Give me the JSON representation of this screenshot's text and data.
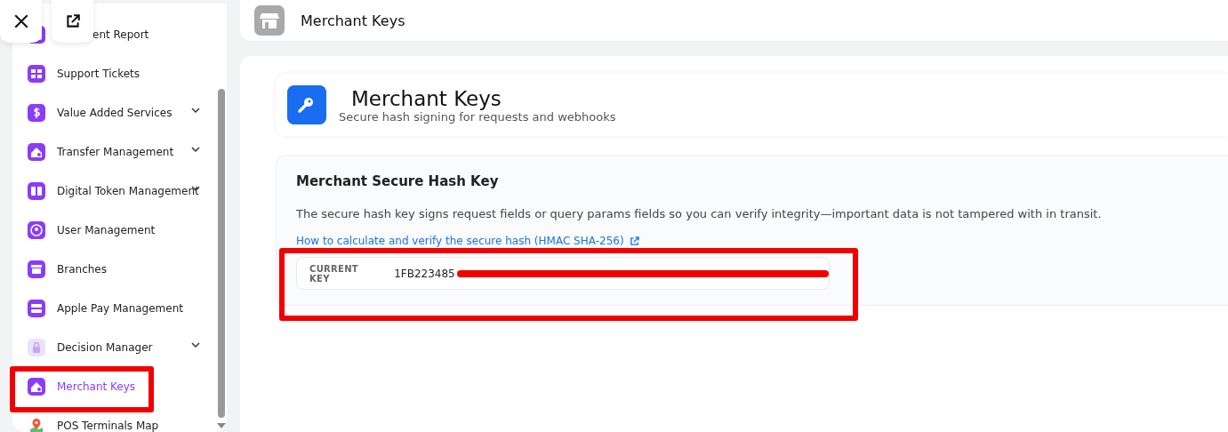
{
  "overlay_buttons": [
    {
      "kind": "close"
    },
    {
      "kind": "external"
    }
  ],
  "sidebar": {
    "items": [
      {
        "label": "ent Report",
        "expandable": false,
        "selected": false,
        "locked": false,
        "highlighted": false
      },
      {
        "label": "Support Tickets",
        "expandable": false,
        "selected": false,
        "locked": false,
        "highlighted": false
      },
      {
        "label": "Value Added Services",
        "expandable": true,
        "selected": false,
        "locked": false,
        "highlighted": false
      },
      {
        "label": "Transfer Management",
        "expandable": true,
        "selected": false,
        "locked": false,
        "highlighted": false
      },
      {
        "label": "Digital Token Management",
        "expandable": true,
        "selected": false,
        "locked": false,
        "highlighted": false
      },
      {
        "label": "User Management",
        "expandable": false,
        "selected": false,
        "locked": false,
        "highlighted": false
      },
      {
        "label": "Branches",
        "expandable": false,
        "selected": false,
        "locked": false,
        "highlighted": false
      },
      {
        "label": "Apple Pay Management",
        "expandable": false,
        "selected": false,
        "locked": false,
        "highlighted": false
      },
      {
        "label": "Decision Manager",
        "expandable": true,
        "selected": false,
        "locked": true,
        "highlighted": false
      },
      {
        "label": "Merchant Keys",
        "expandable": false,
        "selected": true,
        "locked": false,
        "highlighted": true
      },
      {
        "label": "POS Terminals Map",
        "expandable": false,
        "selected": false,
        "locked": false,
        "highlighted": false
      }
    ]
  },
  "top_bar": {
    "title": "Merchant Keys"
  },
  "page_header": {
    "title": "Merchant Keys",
    "subtitle": "Secure hash signing for requests and webhooks"
  },
  "hash_key_card": {
    "title": "Merchant Secure Hash Key",
    "description": "The secure hash key signs request fields or query params fields so you can verify integrity—important data is not tampered with in transit.",
    "link": "How to calculate and verify the secure hash (HMAC SHA-256)",
    "key_label": "CURRENT KEY",
    "key_value": "1FB223485",
    "redacted": true,
    "highlighted": true
  }
}
